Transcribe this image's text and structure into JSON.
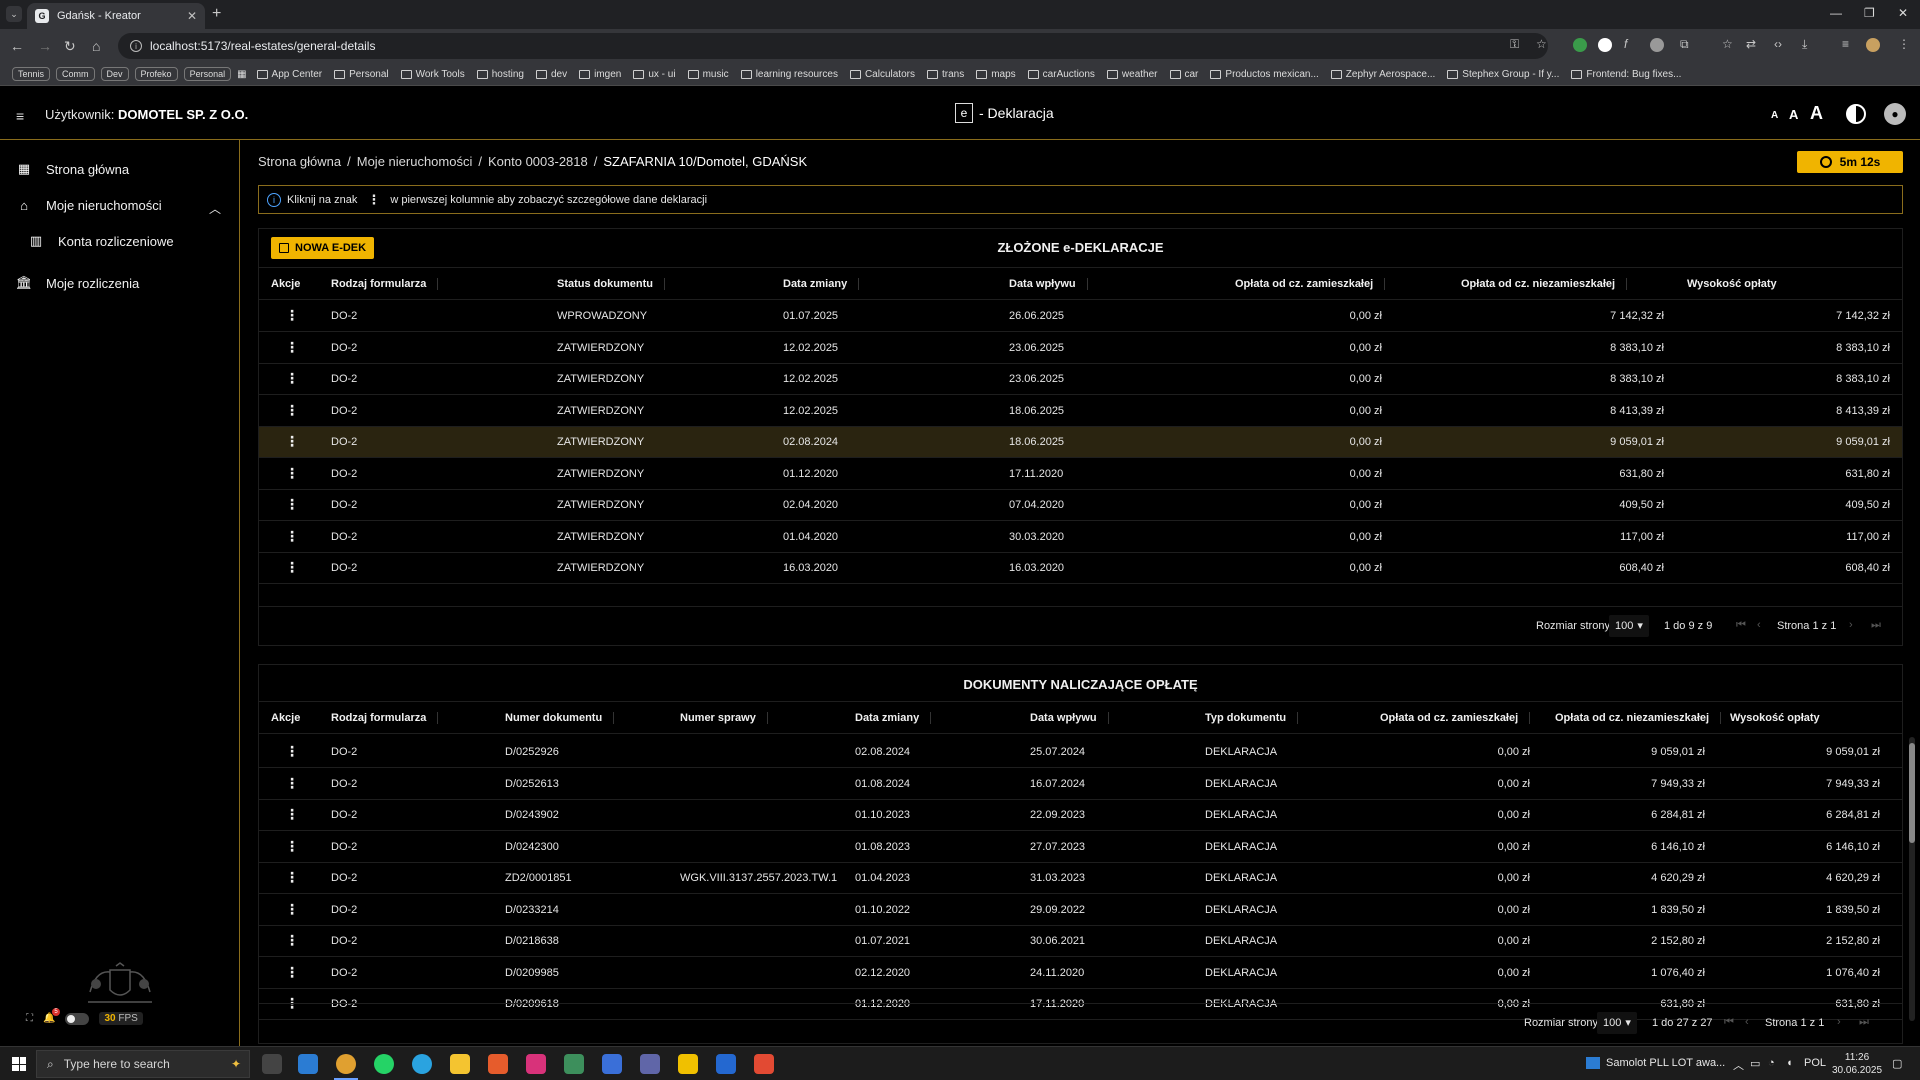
{
  "browser": {
    "tab_title": "Gdańsk - Kreator",
    "url": "localhost:5173/real-estates/general-details",
    "bookmarks_pills": [
      "Tennis",
      "Comm",
      "Dev",
      "Profeko",
      "Personal"
    ],
    "bookmarks": [
      "App Center",
      "Personal",
      "Work Tools",
      "hosting",
      "dev",
      "imgen",
      "ux - ui",
      "music",
      "learning resources",
      "Calculators",
      "trans",
      "maps",
      "carAuctions",
      "weather",
      "car",
      "Productos mexican...",
      "Zephyr Aerospace...",
      "Stephex Group - If y...",
      "Frontend: Bug fixes..."
    ]
  },
  "header": {
    "user_label": "Użytkownik:",
    "user_name": "DOMOTEL SP. Z O.O.",
    "brand_letter": "e",
    "brand_text": "- Deklaracja",
    "font_sizes": [
      "A",
      "A",
      "A"
    ]
  },
  "sidebar": {
    "items": [
      {
        "label": "Strona główna",
        "icon": "grid-icon"
      },
      {
        "label": "Moje nieruchomości",
        "icon": "house-icon"
      },
      {
        "label": "Konta rozliczeniowe",
        "icon": "building-icon"
      },
      {
        "label": "Moje rozliczenia",
        "icon": "bank-icon"
      }
    ],
    "notif_count": "5",
    "fps_value": "30",
    "fps_label": "FPS"
  },
  "breadcrumb": {
    "items": [
      "Strona główna",
      "Moje nieruchomości",
      "Konto 0003-2818"
    ],
    "current": "SZAFARNIA 10/Domotel, GDAŃSK",
    "sep": "/"
  },
  "timer": "5m 12s",
  "info": {
    "before": "Kliknij na znak",
    "after": "w pierwszej kolumnie aby zobaczyć szczegółowe dane deklaracji"
  },
  "declarations": {
    "title": "ZŁOŻONE e-DEKLARACJE",
    "new_button": "NOWA E-DEK",
    "columns": [
      "Akcje",
      "Rodzaj formularza",
      "Status dokumentu",
      "Data zmiany",
      "Data wpływu",
      "Opłata od cz. zamieszkałej",
      "Opłata od cz. niezamieszkałej",
      "Wysokość opłaty"
    ],
    "rows": [
      [
        "DO-2",
        "WPROWADZONY",
        "01.07.2025",
        "26.06.2025",
        "0,00 zł",
        "7 142,32 zł",
        "7 142,32 zł"
      ],
      [
        "DO-2",
        "ZATWIERDZONY",
        "12.02.2025",
        "23.06.2025",
        "0,00 zł",
        "8 383,10 zł",
        "8 383,10 zł"
      ],
      [
        "DO-2",
        "ZATWIERDZONY",
        "12.02.2025",
        "23.06.2025",
        "0,00 zł",
        "8 383,10 zł",
        "8 383,10 zł"
      ],
      [
        "DO-2",
        "ZATWIERDZONY",
        "12.02.2025",
        "18.06.2025",
        "0,00 zł",
        "8 413,39 zł",
        "8 413,39 zł"
      ],
      [
        "DO-2",
        "ZATWIERDZONY",
        "02.08.2024",
        "18.06.2025",
        "0,00 zł",
        "9 059,01 zł",
        "9 059,01 zł"
      ],
      [
        "DO-2",
        "ZATWIERDZONY",
        "01.12.2020",
        "17.11.2020",
        "0,00 zł",
        "631,80 zł",
        "631,80 zł"
      ],
      [
        "DO-2",
        "ZATWIERDZONY",
        "02.04.2020",
        "07.04.2020",
        "0,00 zł",
        "409,50 zł",
        "409,50 zł"
      ],
      [
        "DO-2",
        "ZATWIERDZONY",
        "01.04.2020",
        "30.03.2020",
        "0,00 zł",
        "117,00 zł",
        "117,00 zł"
      ],
      [
        "DO-2",
        "ZATWIERDZONY",
        "16.03.2020",
        "16.03.2020",
        "0,00 zł",
        "608,40 zł",
        "608,40 zł"
      ]
    ],
    "highlighted_row": 4,
    "pager": {
      "size_label": "Rozmiar strony:",
      "size": "100",
      "range": "1 do 9 z 9",
      "page": "Strona 1 z 1"
    }
  },
  "charges": {
    "title": "DOKUMENTY NALICZAJĄCE OPŁATĘ",
    "columns": [
      "Akcje",
      "Rodzaj formularza",
      "Numer dokumentu",
      "Numer sprawy",
      "Data zmiany",
      "Data wpływu",
      "Typ dokumentu",
      "Opłata od cz. zamieszkałej",
      "Opłata od cz. niezamieszkałej",
      "Wysokość opłaty"
    ],
    "rows": [
      [
        "DO-2",
        "D/0252926",
        "",
        "02.08.2024",
        "25.07.2024",
        "DEKLARACJA",
        "0,00 zł",
        "9 059,01 zł",
        "9 059,01 zł"
      ],
      [
        "DO-2",
        "D/0252613",
        "",
        "01.08.2024",
        "16.07.2024",
        "DEKLARACJA",
        "0,00 zł",
        "7 949,33 zł",
        "7 949,33 zł"
      ],
      [
        "DO-2",
        "D/0243902",
        "",
        "01.10.2023",
        "22.09.2023",
        "DEKLARACJA",
        "0,00 zł",
        "6 284,81 zł",
        "6 284,81 zł"
      ],
      [
        "DO-2",
        "D/0242300",
        "",
        "01.08.2023",
        "27.07.2023",
        "DEKLARACJA",
        "0,00 zł",
        "6 146,10 zł",
        "6 146,10 zł"
      ],
      [
        "DO-2",
        "ZD2/0001851",
        "WGK.VIII.3137.2557.2023.TW.1",
        "01.04.2023",
        "31.03.2023",
        "DEKLARACJA",
        "0,00 zł",
        "4 620,29 zł",
        "4 620,29 zł"
      ],
      [
        "DO-2",
        "D/0233214",
        "",
        "01.10.2022",
        "29.09.2022",
        "DEKLARACJA",
        "0,00 zł",
        "1 839,50 zł",
        "1 839,50 zł"
      ],
      [
        "DO-2",
        "D/0218638",
        "",
        "01.07.2021",
        "30.06.2021",
        "DEKLARACJA",
        "0,00 zł",
        "2 152,80 zł",
        "2 152,80 zł"
      ],
      [
        "DO-2",
        "D/0209985",
        "",
        "02.12.2020",
        "24.11.2020",
        "DEKLARACJA",
        "0,00 zł",
        "1 076,40 zł",
        "1 076,40 zł"
      ],
      [
        "DO-2",
        "D/0209618",
        "",
        "01.12.2020",
        "17.11.2020",
        "DEKLARACJA",
        "0,00 zł",
        "631,80 zł",
        "631,80 zł"
      ]
    ],
    "pager": {
      "size_label": "Rozmiar strony:",
      "size": "100",
      "range": "1 do 27 z 27",
      "page": "Strona 1 z 1"
    }
  },
  "taskbar": {
    "search_placeholder": "Type here to search",
    "notification": "Samolot PLL LOT awa...",
    "lang": "POL",
    "time": "11:26",
    "date": "30.06.2025"
  },
  "colors": {
    "accent": "#f0b400",
    "border": "#8a6d1c",
    "highlight_row": "#2a2410"
  }
}
